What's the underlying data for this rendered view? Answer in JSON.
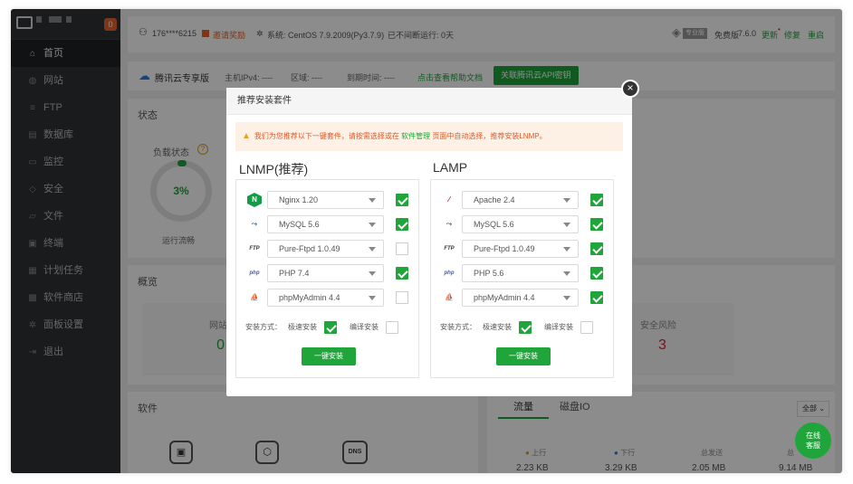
{
  "sidebar": {
    "badge": "0",
    "items": [
      {
        "label": "首页",
        "icon": "home-icon",
        "glyph": "⌂",
        "active": true
      },
      {
        "label": "网站",
        "icon": "globe-icon",
        "glyph": "◍"
      },
      {
        "label": "FTP",
        "icon": "ftp-icon",
        "glyph": "≡"
      },
      {
        "label": "数据库",
        "icon": "database-icon",
        "glyph": "▤"
      },
      {
        "label": "监控",
        "icon": "monitor-icon",
        "glyph": "▭"
      },
      {
        "label": "安全",
        "icon": "shield-icon",
        "glyph": "◇"
      },
      {
        "label": "文件",
        "icon": "folder-icon",
        "glyph": "▱"
      },
      {
        "label": "终端",
        "icon": "terminal-icon",
        "glyph": "▣"
      },
      {
        "label": "计划任务",
        "icon": "calendar-icon",
        "glyph": "▦"
      },
      {
        "label": "软件商店",
        "icon": "apps-icon",
        "glyph": "▩"
      },
      {
        "label": "面板设置",
        "icon": "gear-icon",
        "glyph": "✲"
      },
      {
        "label": "退出",
        "icon": "logout-icon",
        "glyph": "⇥"
      }
    ]
  },
  "topbar": {
    "user": "176****6215",
    "reward": "邀请奖励",
    "system": "系统: CentOS 7.9.2009(Py3.7.9)",
    "uptime": "已不间断运行: 0天",
    "edition_badge": "专业版",
    "edition": "免费版",
    "version": "7.6.0",
    "update": "更新",
    "repair": "修复",
    "restart": "重启"
  },
  "cloudbar": {
    "name": "腾讯云专享版",
    "ipv4": "主机IPv4: ----",
    "region": "区域: ----",
    "expire": "到期时间: ----",
    "help": "点击查看帮助文档",
    "bind_button": "关联腾讯云API密钥"
  },
  "status": {
    "title": "状态",
    "load_label": "负载状态",
    "load_value": "3%",
    "load_percent": 3,
    "load_text": "运行流畅"
  },
  "overview": {
    "title": "概览",
    "site_label": "网站",
    "site_value": "0",
    "risk_label": "安全风险",
    "risk_value": "3"
  },
  "software": {
    "title": "软件",
    "dns_label": "DNS"
  },
  "traffic": {
    "tab_traffic": "流量",
    "tab_disk": "磁盘IO",
    "filter": "全部",
    "up_label": "上行",
    "up_value": "2.23 KB",
    "down_label": "下行",
    "down_value": "3.29 KB",
    "sent_label": "总发送",
    "sent_value": "2.05 MB",
    "recv_label": "总",
    "recv_value": "9.14 MB"
  },
  "modal": {
    "title": "推荐安装套件",
    "warning_pre": "我们为您推荐以下一键套件，请按需选择或在 ",
    "warning_link": "软件管理",
    "warning_post": " 页面中自动选择，推荐安装LNMP。",
    "lnmp": {
      "title": "LNMP(推荐)",
      "items": [
        {
          "name": "Nginx 1.20",
          "icon": "nginx-icon",
          "glyph": "N",
          "checked": true
        },
        {
          "name": "MySQL 5.6",
          "icon": "mysql-icon",
          "glyph": "⤳",
          "checked": true
        },
        {
          "name": "Pure-Ftpd 1.0.49",
          "icon": "ftp-icon",
          "glyph": "FTP",
          "checked": false
        },
        {
          "name": "PHP 7.4",
          "icon": "php-icon",
          "glyph": "php",
          "checked": true
        },
        {
          "name": "phpMyAdmin 4.4",
          "icon": "phpmyadmin-icon",
          "glyph": "⛵",
          "checked": false
        }
      ],
      "mode_label": "安装方式：",
      "fast_label": "极速安装",
      "fast_checked": true,
      "compile_label": "编译安装",
      "compile_checked": false,
      "button": "一键安装"
    },
    "lamp": {
      "title": "LAMP",
      "items": [
        {
          "name": "Apache 2.4",
          "icon": "apache-icon",
          "glyph": "⁄",
          "checked": true
        },
        {
          "name": "MySQL 5.6",
          "icon": "mysql-icon",
          "glyph": "⤳",
          "checked": true
        },
        {
          "name": "Pure-Ftpd 1.0.49",
          "icon": "ftp-icon",
          "glyph": "FTP",
          "checked": true
        },
        {
          "name": "PHP 5.6",
          "icon": "php-icon",
          "glyph": "php",
          "checked": true
        },
        {
          "name": "phpMyAdmin 4.4",
          "icon": "phpmyadmin-icon",
          "glyph": "⛵",
          "checked": true
        }
      ],
      "mode_label": "安装方式：",
      "fast_label": "极速安装",
      "fast_checked": true,
      "compile_label": "编译安装",
      "compile_checked": false,
      "button": "一键安装"
    }
  },
  "chat": {
    "line1": "在线",
    "line2": "客服"
  },
  "colors": {
    "accent": "#20a53a",
    "sidebar": "#2f3236",
    "warning": "#e05a2a",
    "danger": "#d8262e"
  }
}
